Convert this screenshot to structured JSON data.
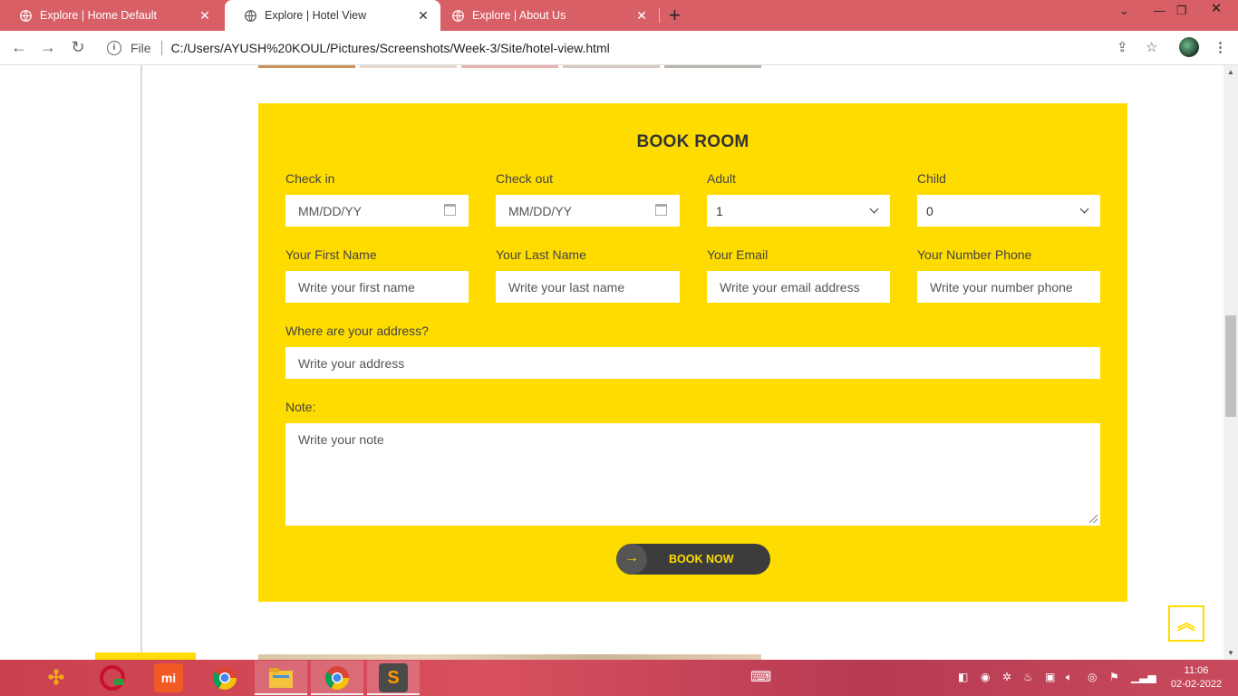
{
  "browser": {
    "tabs": [
      {
        "title": "Explore | Home Default",
        "active": false
      },
      {
        "title": "Explore | Hotel View",
        "active": true
      },
      {
        "title": "Explore | About Us",
        "active": false
      }
    ],
    "address": {
      "scheme_label": "File",
      "url": "C:/Users/AYUSH%20KOUL/Pictures/Screenshots/Week-3/Site/hotel-view.html"
    }
  },
  "booking": {
    "title": "BOOK ROOM",
    "checkin": {
      "label": "Check in",
      "placeholder": "MM/DD/YY"
    },
    "checkout": {
      "label": "Check out",
      "placeholder": "MM/DD/YY"
    },
    "adult": {
      "label": "Adult",
      "value": "1"
    },
    "child": {
      "label": "Child",
      "value": "0"
    },
    "first_name": {
      "label": "Your First Name",
      "placeholder": "Write your first name"
    },
    "last_name": {
      "label": "Your Last Name",
      "placeholder": "Write your last name"
    },
    "email": {
      "label": "Your Email",
      "placeholder": "Write your email address"
    },
    "phone": {
      "label": "Your Number Phone",
      "placeholder": "Write your number phone"
    },
    "address": {
      "label": "Where are your address?",
      "placeholder": "Write your address"
    },
    "note": {
      "label": "Note:",
      "placeholder": "Write your note"
    },
    "submit_label": "BOOK NOW"
  },
  "taskbar": {
    "clock_time": "11:06",
    "clock_date": "02-02-2022"
  },
  "colors": {
    "accent_yellow": "#ffdc00",
    "tab_bar": "#d95f67",
    "button_dark": "#3c3c3c"
  }
}
